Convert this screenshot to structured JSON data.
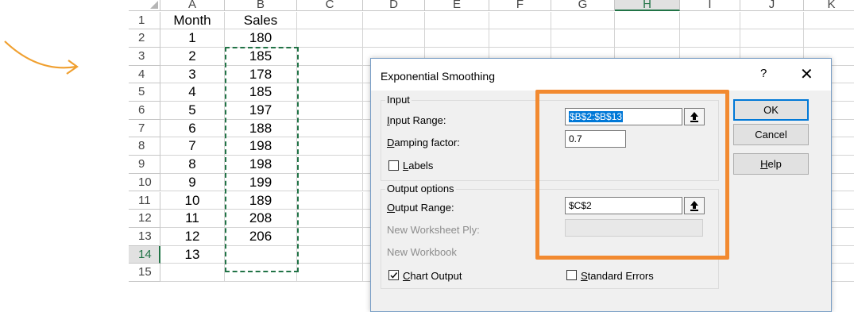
{
  "spreadsheet": {
    "columns": [
      "A",
      "B",
      "C",
      "D",
      "E",
      "F",
      "G",
      "H",
      "I",
      "J",
      "K"
    ],
    "selected_column": "H",
    "selected_row": "14",
    "rows": [
      {
        "row": "1",
        "a": "Month",
        "b": "Sales"
      },
      {
        "row": "2",
        "a": "1",
        "b": "180"
      },
      {
        "row": "3",
        "a": "2",
        "b": "185"
      },
      {
        "row": "4",
        "a": "3",
        "b": "178"
      },
      {
        "row": "5",
        "a": "4",
        "b": "185"
      },
      {
        "row": "6",
        "a": "5",
        "b": "197"
      },
      {
        "row": "7",
        "a": "6",
        "b": "188"
      },
      {
        "row": "8",
        "a": "7",
        "b": "198"
      },
      {
        "row": "9",
        "a": "8",
        "b": "198"
      },
      {
        "row": "10",
        "a": "9",
        "b": "199"
      },
      {
        "row": "11",
        "a": "10",
        "b": "189"
      },
      {
        "row": "12",
        "a": "11",
        "b": "208"
      },
      {
        "row": "13",
        "a": "12",
        "b": "206"
      },
      {
        "row": "14",
        "a": "13",
        "b": ""
      },
      {
        "row": "15",
        "a": "",
        "b": ""
      }
    ]
  },
  "dialog": {
    "title": "Exponential Smoothing",
    "help_symbol": "?",
    "close_symbol": "✕",
    "input_group": "Input",
    "input_range_label_u": "I",
    "input_range_label_rest": "nput Range:",
    "input_range_value": "$B$2:$B$13",
    "damping_label_u": "D",
    "damping_label_rest": "amping factor:",
    "damping_value": "0.7",
    "labels_label_u": "L",
    "labels_label_rest": "abels",
    "output_group": "Output options",
    "output_range_label_u": "O",
    "output_range_label_rest": "utput Range:",
    "output_range_value": "$C$2",
    "new_worksheet_label": "New Worksheet Ply:",
    "new_workbook_label": "New Workbook",
    "chart_output_label_u": "C",
    "chart_output_label_rest": "hart Output",
    "standard_errors_label_u": "S",
    "standard_errors_label_rest": "tandard Errors",
    "ok_label": "OK",
    "cancel_label": "Cancel",
    "help_label_u": "H",
    "help_label_rest": "elp",
    "chart_output_checked": true,
    "labels_checked": false,
    "standard_errors_checked": false
  },
  "colors": {
    "accent_excel": "#217346",
    "highlight": "#f28a30",
    "arrow": "#f0a030",
    "focus": "#0078d7"
  }
}
